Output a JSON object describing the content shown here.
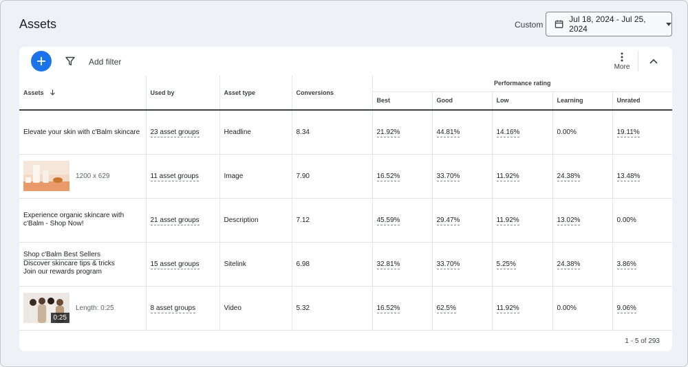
{
  "page": {
    "title": "Assets",
    "custom_label": "Custom",
    "date_range": "Jul 18, 2024 - Jul 25, 2024"
  },
  "toolbar": {
    "add_filter": "Add filter",
    "more_label": "More"
  },
  "table": {
    "headers": {
      "assets": "Assets",
      "used_by": "Used by",
      "asset_type": "Asset type",
      "conversions": "Conversions",
      "performance_rating": "Performance rating",
      "best": "Best",
      "good": "Good",
      "low": "Low",
      "learning": "Learning",
      "unrated": "Unrated"
    },
    "rows": [
      {
        "asset": "Elevate your skin with c'Balm skincare",
        "used_by": "23 asset groups",
        "type": "Headline",
        "conversions": "8.34",
        "best": "21.92%",
        "good": "44.81%",
        "low": "14.16%",
        "learning": "0.00%",
        "unrated": "19.11%"
      },
      {
        "asset_dims": "1200 x 629",
        "used_by": "11 asset groups",
        "type": "Image",
        "conversions": "7.90",
        "best": "16.52%",
        "good": "33.70%",
        "low": "11.92%",
        "learning": "24.38%",
        "unrated": "13.48%"
      },
      {
        "asset": "Experience organic skincare with c'Balm - Shop Now!",
        "used_by": "21 asset groups",
        "type": "Description",
        "conversions": "7.12",
        "best": "45.59%",
        "good": "29.47%",
        "low": "11.92%",
        "learning": "13.02%",
        "unrated": "0.00%"
      },
      {
        "sitelinks": [
          "Shop c'Balm Best Sellers",
          "Discover skincare tips & tricks",
          "Join our rewards program"
        ],
        "used_by": "15 asset groups",
        "type": "Sitelink",
        "conversions": "6.98",
        "best": "32.81%",
        "good": "33.70%",
        "low": "5.25%",
        "learning": "24.38%",
        "unrated": "3.86%"
      },
      {
        "video_duration": "0:25",
        "video_length": "Length: 0:25",
        "used_by": "8 asset groups",
        "type": "Video",
        "conversions": "5.32",
        "best": "16.52%",
        "good": "62.5%",
        "low": "11.92%",
        "learning": "0.00%",
        "unrated": "9.06%"
      }
    ]
  },
  "pagination": "1 - 5 of 293",
  "colors": {
    "accent": "#1a73e8",
    "background": "#eef1f5"
  }
}
